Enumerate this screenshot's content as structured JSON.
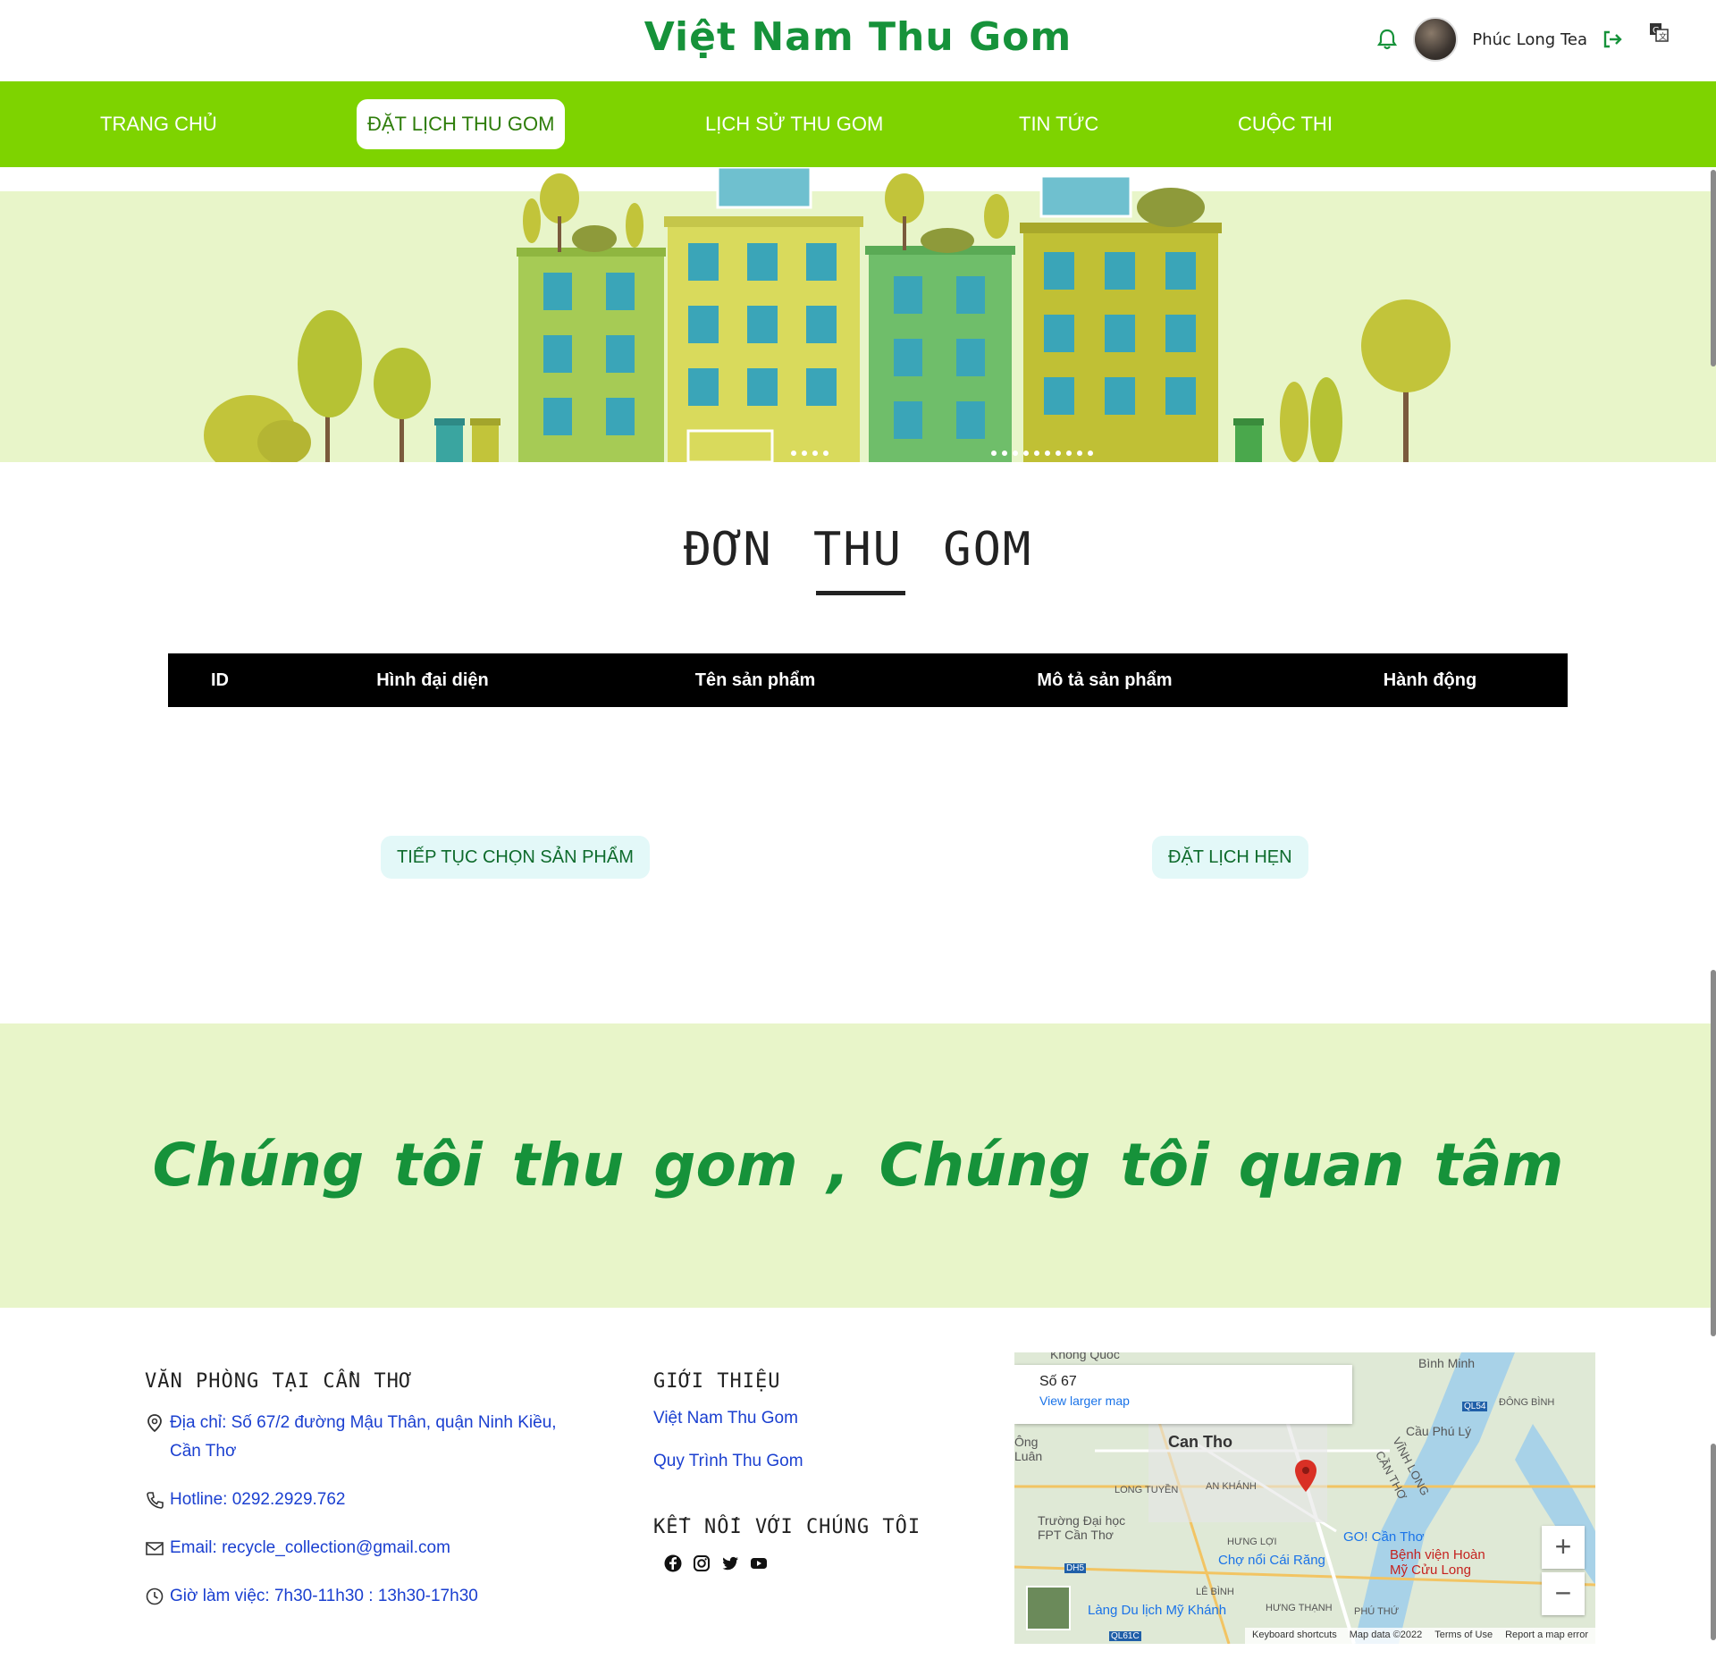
{
  "header": {
    "site_title": "Việt Nam Thu Gom",
    "username": "Phúc Long Tea"
  },
  "nav": {
    "items": [
      {
        "label": "TRANG CHỦ",
        "active": false
      },
      {
        "label": "ĐẶT LỊCH THU GOM",
        "active": true
      },
      {
        "label": "LỊCH SỬ THU GOM",
        "active": false
      },
      {
        "label": "TIN TỨC",
        "active": false
      },
      {
        "label": "CUỘC THI",
        "active": false
      }
    ]
  },
  "main": {
    "section_title": "ĐƠN THU GOM",
    "table_headers": [
      "ID",
      "Hình đại diện",
      "Tên sản phẩm",
      "Mô tả sản phẩm",
      "Hành động"
    ],
    "continue_button": "TIẾP TỤC CHỌN SẢN PHẨM",
    "book_button": "ĐẶT LỊCH HẸN"
  },
  "slogan": "Chúng tôi thu gom , Chúng tôi quan tâm",
  "footer": {
    "office_heading": "VĂN PHÒNG TẠI CẦN THƠ",
    "address": "Địa chỉ: Số 67/2 đường Mậu Thân, quận Ninh Kiều, Cần Thơ",
    "hotline": "Hotline: 0292.2929.762",
    "email": "Email: recycle_collection@gmail.com",
    "hours": "Giờ làm việc: 7h30-11h30 : 13h30-17h30",
    "intro_heading": "GIỚI THIỆU",
    "intro_links": [
      "Việt Nam Thu Gom",
      "Quy Trình Thu Gom"
    ],
    "connect_heading": "KẾT NỐI VỚI CHÚNG TÔI"
  },
  "map": {
    "place": "Số 67",
    "view_larger": "View larger map",
    "labels": [
      "Can Tho",
      "Bình Minh",
      "Cầu Phú Lý",
      "GO! Cần Thơ",
      "Bệnh viện Hoàn Mỹ Cửu Long",
      "Chợ nổi Cái Răng",
      "Trường Đại học FPT Cần Thơ",
      "Làng Du lịch Mỹ Khánh",
      "AN KHÁNH",
      "LONG TUYỀN",
      "HƯNG LỢI",
      "LÊ BÌNH",
      "HƯNG THẠNH",
      "PHÚ THỨ",
      "ĐÔNG BÌNH",
      "VĨNH LONG",
      "CẦN THƠ",
      "Ông Luân",
      "QL54",
      "DH5",
      "QL61C",
      "Không Quốc"
    ],
    "footer_links": [
      "Keyboard shortcuts",
      "Map data ©2022",
      "Terms of Use",
      "Report a map error"
    ],
    "zoom_in": "+",
    "zoom_out": "−"
  },
  "colors": {
    "brand_green": "#16923a",
    "nav_green": "#7ed300",
    "banner_bg": "#e8f5c9",
    "link_blue": "#1a3fd0"
  }
}
